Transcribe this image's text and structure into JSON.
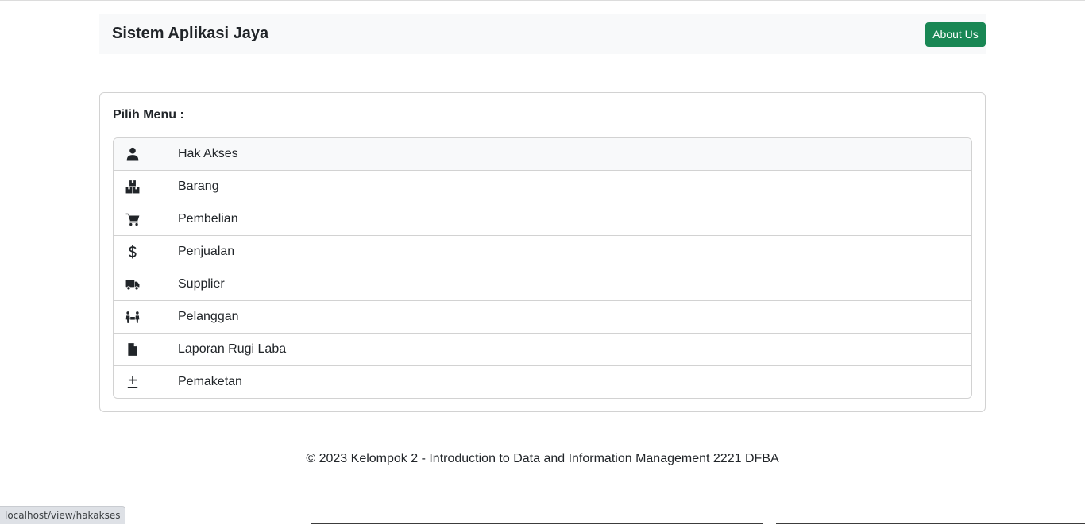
{
  "navbar": {
    "brand": "Sistem Aplikasi Jaya",
    "about_button": "About Us",
    "about_color": "#198754"
  },
  "card": {
    "title": "Pilih Menu :"
  },
  "menu": {
    "items": [
      {
        "label": "Hak Akses",
        "icon": "user-icon",
        "active": true
      },
      {
        "label": "Barang",
        "icon": "boxes-icon"
      },
      {
        "label": "Pembelian",
        "icon": "cart-icon"
      },
      {
        "label": "Penjualan",
        "icon": "dollar-icon"
      },
      {
        "label": "Supplier",
        "icon": "truck-icon"
      },
      {
        "label": "Pelanggan",
        "icon": "people-icon"
      },
      {
        "label": "Laporan Rugi Laba",
        "icon": "file-icon"
      },
      {
        "label": "Pemaketan",
        "icon": "plus-minus-icon"
      }
    ]
  },
  "footer": {
    "text": "© 2023 Kelompok 2 - Introduction to Data and Information Management 2221 DFBA"
  },
  "status_bar": {
    "url": "localhost/view/hakakses"
  }
}
